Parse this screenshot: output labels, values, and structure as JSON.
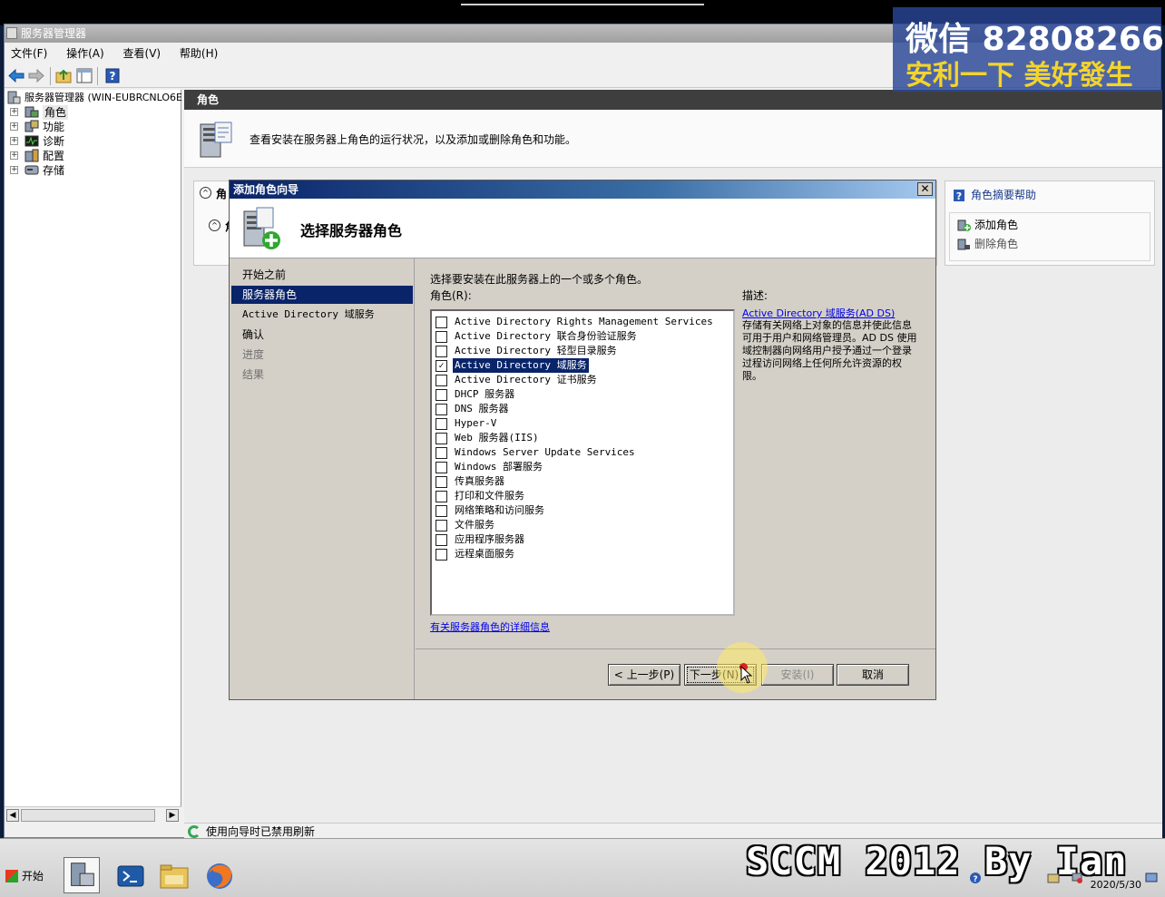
{
  "window": {
    "title": "服务器管理器",
    "menu": [
      "文件(F)",
      "操作(A)",
      "查看(V)",
      "帮助(H)"
    ]
  },
  "tree": {
    "root": "服务器管理器 (WIN-EUBRCNLO6E",
    "items": [
      "角色",
      "功能",
      "诊断",
      "配置",
      "存储"
    ]
  },
  "content": {
    "header": "角色",
    "banner_text": "查看安装在服务器上角色的运行状况，以及添加或删除角色和功能。",
    "summary_header": "角",
    "summary_sub": "角"
  },
  "actions": {
    "help": "角色摘要帮助",
    "add_role": "添加角色",
    "remove_role": "删除角色"
  },
  "statusbar": {
    "text": "使用向导时已禁用刷新"
  },
  "dialog": {
    "title": "添加角色向导",
    "heading": "选择服务器角色",
    "nav": [
      {
        "label": "开始之前",
        "state": "normal"
      },
      {
        "label": "服务器角色",
        "state": "selected"
      },
      {
        "label": "Active Directory 域服务",
        "state": "normal"
      },
      {
        "label": "确认",
        "state": "normal"
      },
      {
        "label": "进度",
        "state": "disabled"
      },
      {
        "label": "结果",
        "state": "disabled"
      }
    ],
    "instruction": "选择要安装在此服务器上的一个或多个角色。",
    "roles_label": "角色(R):",
    "roles": [
      {
        "label": "Active Directory Rights Management Services",
        "checked": false
      },
      {
        "label": "Active Directory 联合身份验证服务",
        "checked": false
      },
      {
        "label": "Active Directory 轻型目录服务",
        "checked": false
      },
      {
        "label": "Active Directory 域服务",
        "checked": true
      },
      {
        "label": "Active Directory 证书服务",
        "checked": false
      },
      {
        "label": "DHCP 服务器",
        "checked": false
      },
      {
        "label": "DNS 服务器",
        "checked": false
      },
      {
        "label": "Hyper-V",
        "checked": false
      },
      {
        "label": "Web 服务器(IIS)",
        "checked": false
      },
      {
        "label": "Windows Server Update Services",
        "checked": false
      },
      {
        "label": "Windows 部署服务",
        "checked": false
      },
      {
        "label": "传真服务器",
        "checked": false
      },
      {
        "label": "打印和文件服务",
        "checked": false
      },
      {
        "label": "网络策略和访问服务",
        "checked": false
      },
      {
        "label": "文件服务",
        "checked": false
      },
      {
        "label": "应用程序服务器",
        "checked": false
      },
      {
        "label": "远程桌面服务",
        "checked": false
      }
    ],
    "description_label": "描述:",
    "description_link": "Active Directory 域服务(AD DS)",
    "description_text": "存储有关网络上对象的信息并使此信息可用于用户和网络管理员。AD DS 使用域控制器向网络用户授予通过一个登录过程访问网络上任何所允许资源的权限。",
    "more_link": "有关服务器角色的详细信息",
    "buttons": {
      "prev": "< 上一步(P)",
      "next": "下一步(N) >",
      "install": "安装(I)",
      "cancel": "取消"
    }
  },
  "watermark": {
    "line1": "微信 82808266",
    "line2": "安利一下 美好發生"
  },
  "taskbar": {
    "start": "开始",
    "overlay": "SCCM 2012 By Ian",
    "date": "2020/5/30"
  },
  "colors": {
    "selection": "#0a246a",
    "link": "#0000ee",
    "watermark_yellow": "#f4d42a"
  }
}
